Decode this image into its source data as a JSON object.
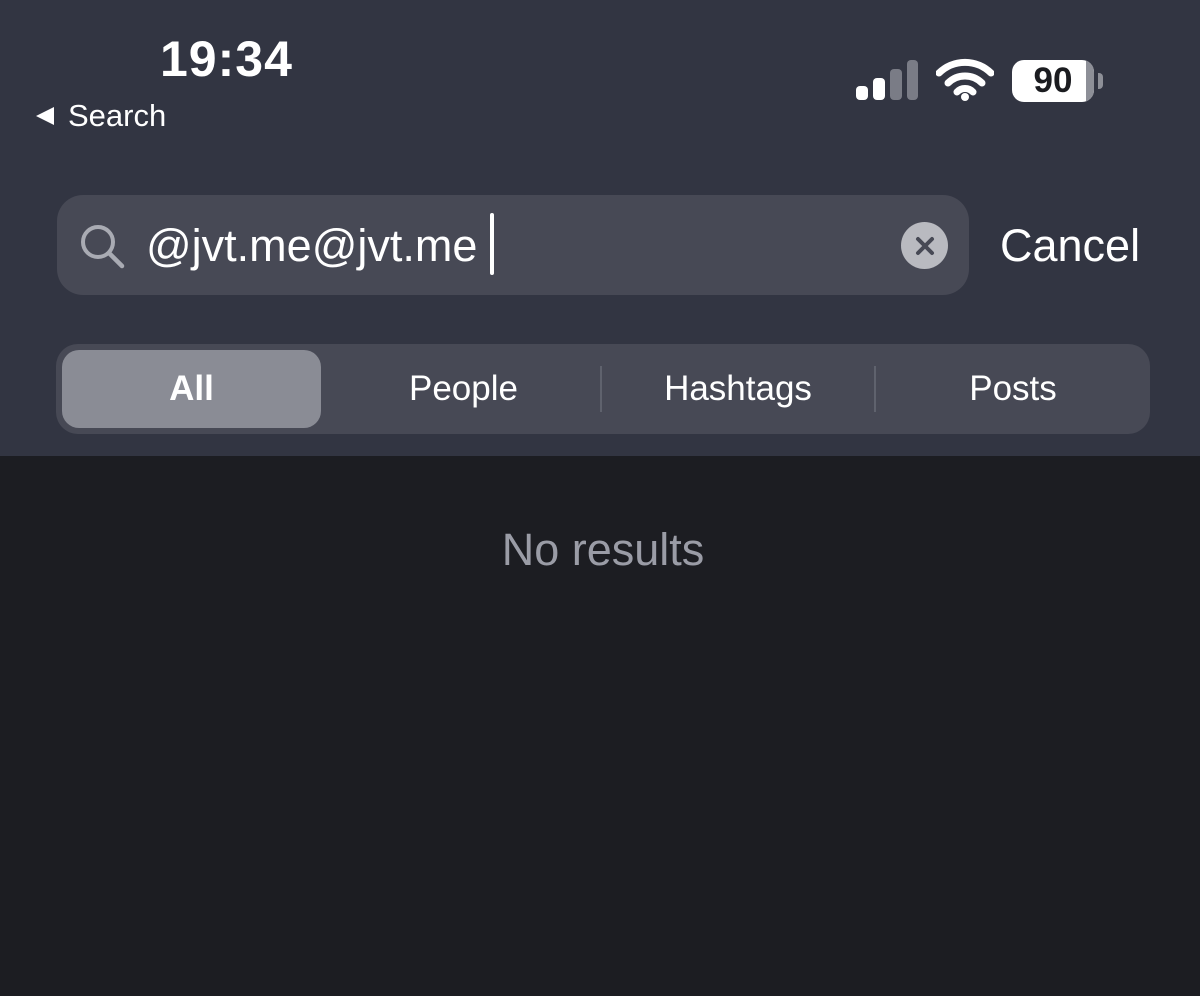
{
  "status_bar": {
    "time": "19:34",
    "back_label": "Search",
    "battery_level": "90"
  },
  "search": {
    "query": "@jvt.me@jvt.me",
    "cancel_label": "Cancel"
  },
  "tabs": [
    {
      "label": "All",
      "selected": true
    },
    {
      "label": "People",
      "selected": false
    },
    {
      "label": "Hashtags",
      "selected": false
    },
    {
      "label": "Posts",
      "selected": false
    }
  ],
  "results": {
    "empty_message": "No results"
  },
  "colors": {
    "header_bg": "#323542",
    "content_bg": "#1c1d22",
    "field_bg": "#474955",
    "selected_tab_bg": "#8a8c95",
    "muted_text": "#9a9ca6"
  },
  "icons": [
    "back-arrow-icon",
    "cellular-signal-icon",
    "wifi-icon",
    "battery-icon",
    "search-icon",
    "clear-icon"
  ]
}
